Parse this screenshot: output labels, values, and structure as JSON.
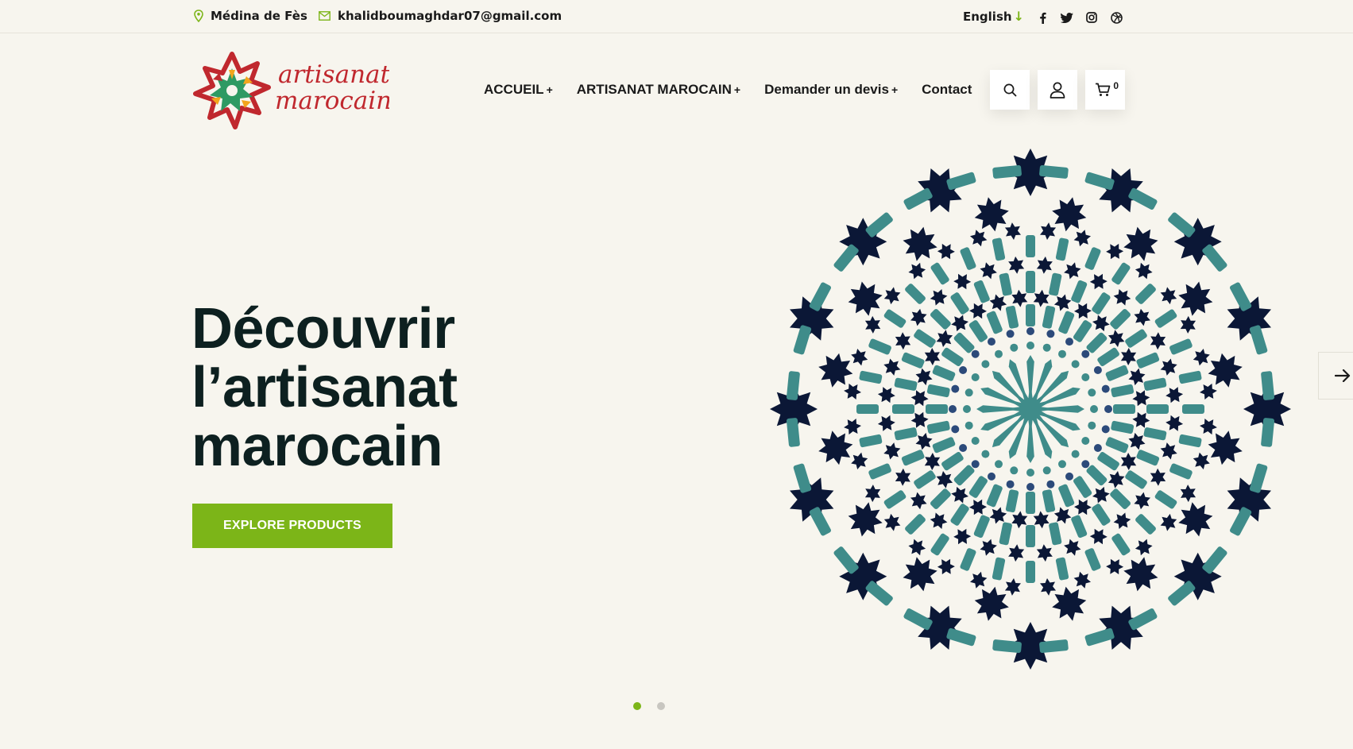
{
  "topbar": {
    "location": "Médina de Fès",
    "email": "khalidboumaghdar07@gmail.com",
    "language": "English",
    "socials": [
      "facebook-icon",
      "twitter-icon",
      "instagram-icon",
      "dribbble-icon"
    ]
  },
  "logo": {
    "line1": "artisanat",
    "line2": "marocain"
  },
  "nav": {
    "items": [
      {
        "label": "ACCUEIL",
        "suffix": "+"
      },
      {
        "label": "ARTISANAT MAROCAIN",
        "suffix": "+"
      },
      {
        "label": "Demander un devis",
        "suffix": "+"
      },
      {
        "label": "Contact",
        "suffix": ""
      }
    ]
  },
  "header": {
    "cart_count": "0"
  },
  "hero": {
    "title_lines": [
      "Découvrir",
      "l’artisanat",
      "marocain"
    ],
    "cta": "EXPLORE PRODUCTS"
  },
  "slider": {
    "slides": 2,
    "active": 1
  },
  "colors": {
    "accent": "#7cb518",
    "background": "#f7f5ee",
    "heading": "#0d2020",
    "mosaic_dark": "#0b1736",
    "mosaic_teal": "#3f8c8a",
    "logo_red": "#c0282e"
  }
}
